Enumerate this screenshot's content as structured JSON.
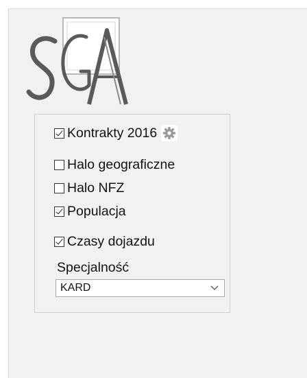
{
  "logo": {
    "text": "SGA"
  },
  "options": [
    {
      "label": "Kontrakty 2016",
      "checked": true,
      "has_settings": true,
      "settings_icon": "gear-icon"
    },
    {
      "label": "Halo geograficzne",
      "checked": false
    },
    {
      "label": "Halo NFZ",
      "checked": false
    },
    {
      "label": "Populacja",
      "checked": true
    },
    {
      "label": "Czasy dojazdu",
      "checked": true
    }
  ],
  "specialty": {
    "label": "Specjalność",
    "selected": "KARD",
    "dropdown_icon": "chevron-down-icon"
  }
}
